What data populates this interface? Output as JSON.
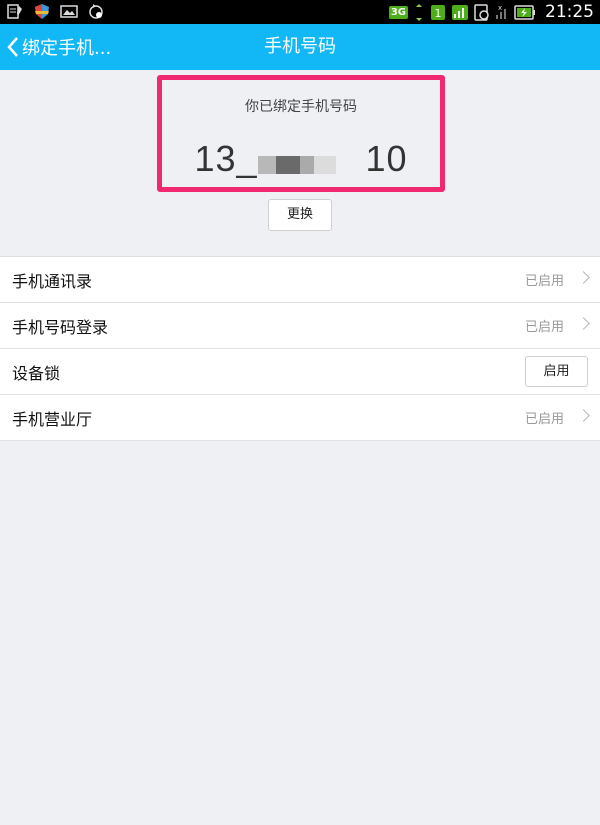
{
  "status_bar": {
    "left_icons": [
      "notes-icon",
      "shield-icon",
      "image-icon",
      "sync-icon"
    ],
    "network_badge": "3G",
    "time": "21:25"
  },
  "title_bar": {
    "back_label": "绑定手机...",
    "title": "手机号码"
  },
  "bound_phone": {
    "caption": "你已绑定手机号码",
    "number_prefix": "13_",
    "number_suffix": "10",
    "highlight_color": "#f0286e"
  },
  "change_button": {
    "label": "更换"
  },
  "settings": [
    {
      "label": "手机通讯录",
      "status": "已启用"
    },
    {
      "label": "手机号码登录",
      "status": "已启用"
    },
    {
      "label": "设备锁",
      "button": "启用"
    },
    {
      "label": "手机营业厅",
      "status": "已启用"
    }
  ],
  "colors": {
    "title_bar": "#12b7f5",
    "background": "#eef0f4"
  }
}
